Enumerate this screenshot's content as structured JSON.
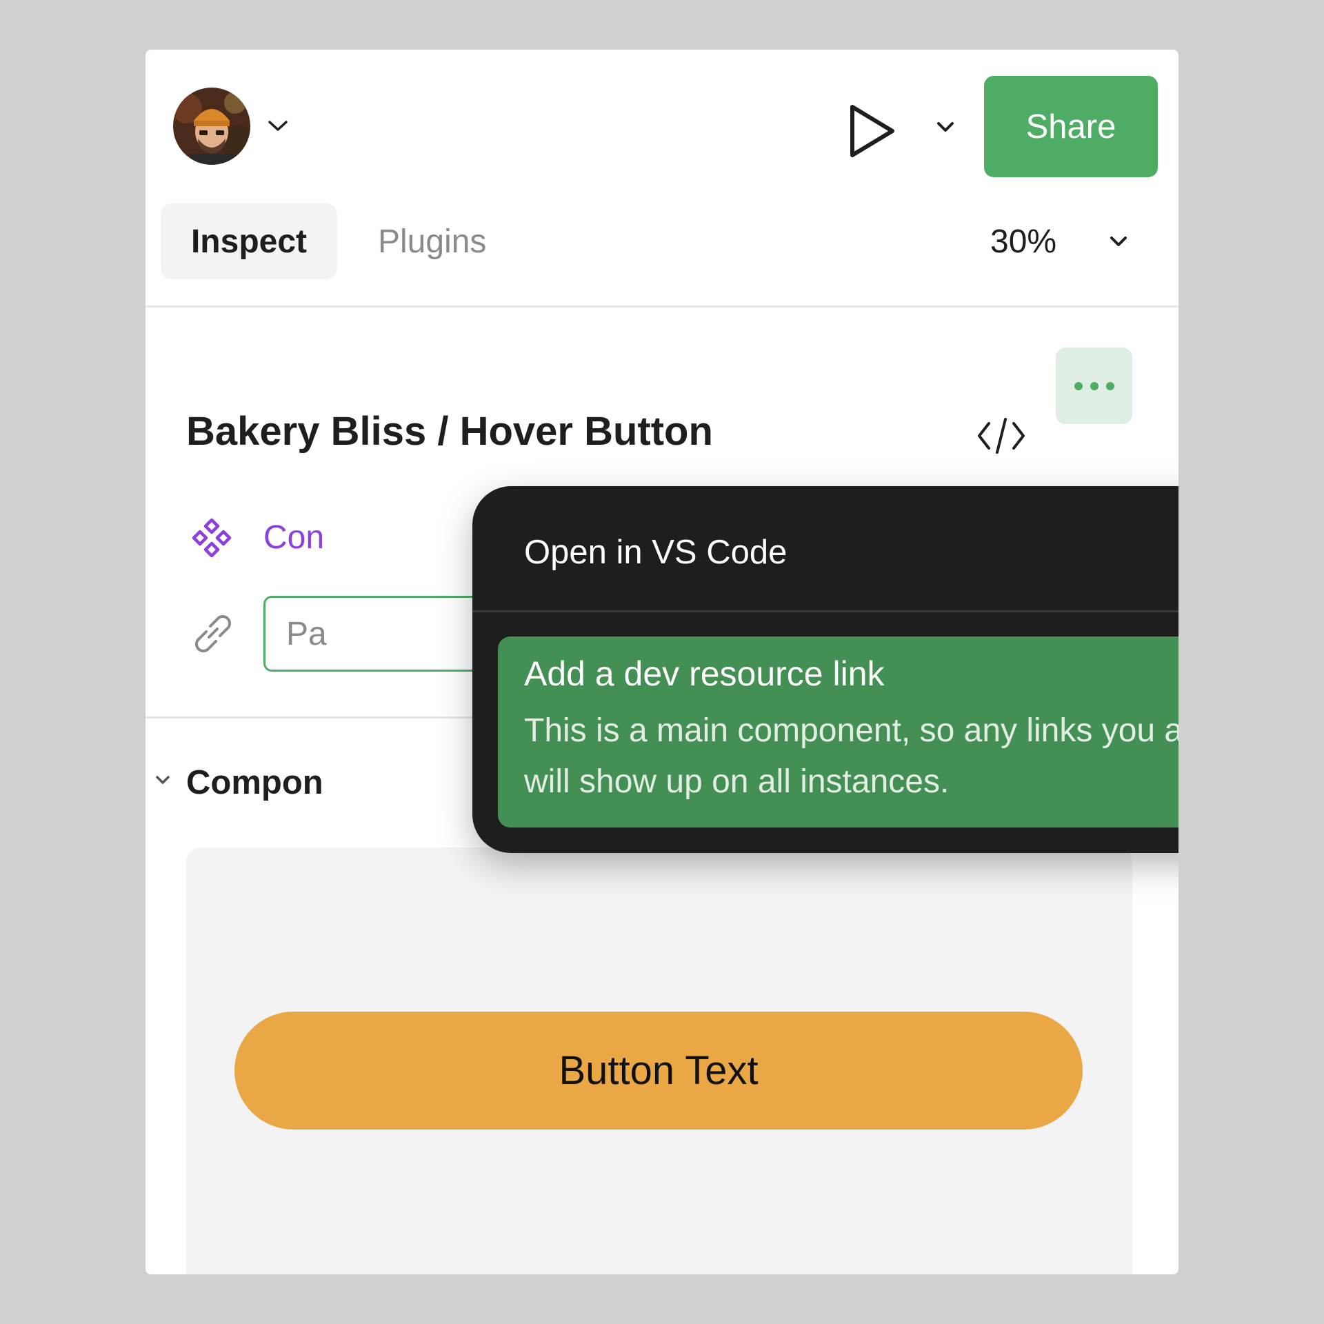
{
  "header": {
    "share_label": "Share"
  },
  "tabs": [
    {
      "label": "Inspect",
      "active": true
    },
    {
      "label": "Plugins",
      "active": false
    }
  ],
  "zoom": {
    "value": "30%"
  },
  "selection": {
    "title": "Bakery Bliss / Hover Button",
    "component_link_text": "Con",
    "dev_link_placeholder": "Pa"
  },
  "section": {
    "title": "Compon"
  },
  "preview": {
    "button_text": "Button Text"
  },
  "menu": {
    "items": [
      {
        "label": "Open in VS Code"
      },
      {
        "label": "Add a dev resource link",
        "description": "This is a main component, so any links you add will show up on all instances."
      }
    ]
  },
  "colors": {
    "accent": "#4fac64",
    "menu_bg": "#1e1e1e",
    "menu_highlight": "#448f54",
    "component_purple": "#8b3fe0",
    "preview_button": "#eaa745"
  },
  "icons": [
    "avatar",
    "chevron-down-icon",
    "play-icon",
    "code-icon",
    "more-horizontal-icon",
    "component-icon",
    "link-icon"
  ]
}
